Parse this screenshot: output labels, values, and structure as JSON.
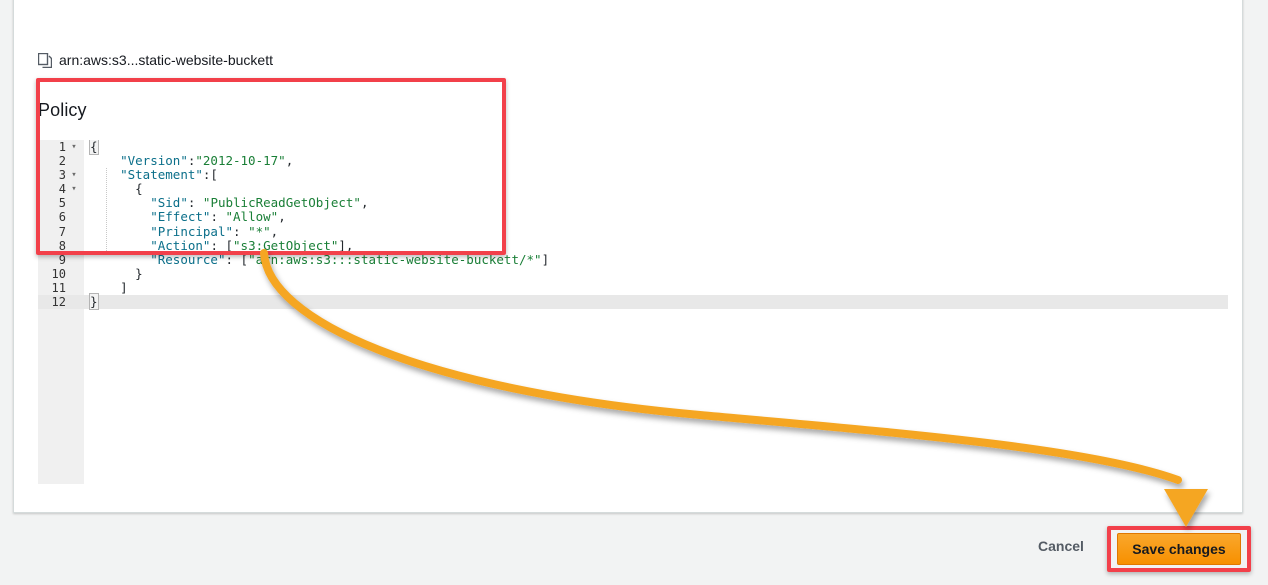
{
  "page": {
    "background_color": "#f2f3f3",
    "panel_background": "#ffffff"
  },
  "breadcrumb": {
    "icon": "copy-icon",
    "arn_text": "arn:aws:s3...static-website-buckett"
  },
  "policy_section": {
    "heading": "Policy"
  },
  "editor": {
    "language": "json",
    "gutter": [
      {
        "number": "1",
        "foldable": true,
        "fold_glyph": "▾"
      },
      {
        "number": "2",
        "foldable": false,
        "fold_glyph": ""
      },
      {
        "number": "3",
        "foldable": true,
        "fold_glyph": "▾"
      },
      {
        "number": "4",
        "foldable": true,
        "fold_glyph": "▾"
      },
      {
        "number": "5",
        "foldable": false,
        "fold_glyph": ""
      },
      {
        "number": "6",
        "foldable": false,
        "fold_glyph": ""
      },
      {
        "number": "7",
        "foldable": false,
        "fold_glyph": ""
      },
      {
        "number": "8",
        "foldable": false,
        "fold_glyph": ""
      },
      {
        "number": "9",
        "foldable": false,
        "fold_glyph": ""
      },
      {
        "number": "10",
        "foldable": false,
        "fold_glyph": ""
      },
      {
        "number": "11",
        "foldable": false,
        "fold_glyph": ""
      },
      {
        "number": "12",
        "foldable": false,
        "fold_glyph": ""
      }
    ],
    "active_line": 12,
    "lines": [
      {
        "n": 1,
        "text": "{"
      },
      {
        "n": 2,
        "text": "    \"Version\":\"2012-10-17\","
      },
      {
        "n": 3,
        "text": "    \"Statement\":["
      },
      {
        "n": 4,
        "text": "      {"
      },
      {
        "n": 5,
        "text": "        \"Sid\": \"PublicReadGetObject\","
      },
      {
        "n": 6,
        "text": "        \"Effect\": \"Allow\","
      },
      {
        "n": 7,
        "text": "        \"Principal\": \"*\","
      },
      {
        "n": 8,
        "text": "        \"Action\": [\"s3:GetObject\"],"
      },
      {
        "n": 9,
        "text": "        \"Resource\": [\"arn:aws:s3:::static-website-buckett/*\"]"
      },
      {
        "n": 10,
        "text": "      }"
      },
      {
        "n": 11,
        "text": "    ]"
      },
      {
        "n": 12,
        "text": "}"
      }
    ],
    "policy_document": {
      "Version": "2012-10-17",
      "Statement": [
        {
          "Sid": "PublicReadGetObject",
          "Effect": "Allow",
          "Principal": "*",
          "Action": [
            "s3:GetObject"
          ],
          "Resource": [
            "arn:aws:s3:::static-website-buckett/*"
          ]
        }
      ]
    },
    "colors": {
      "key": "#0b6f8a",
      "string": "#1a7f37",
      "punctuation": "#24292e",
      "gutter_background": "#f0f0f0",
      "active_line_background": "#e8e8e8"
    }
  },
  "footer": {
    "cancel_label": "Cancel",
    "save_label": "Save changes",
    "save_color": "#f79000"
  },
  "annotations": {
    "highlight_color": "#f2404a",
    "arrow_color": "#f5a623",
    "boxes": [
      {
        "name": "policy-editor-highlight"
      },
      {
        "name": "save-changes-highlight"
      }
    ],
    "arrow": {
      "name": "curved-arrow",
      "from": "policy-editor",
      "to": "save-changes-button"
    }
  }
}
